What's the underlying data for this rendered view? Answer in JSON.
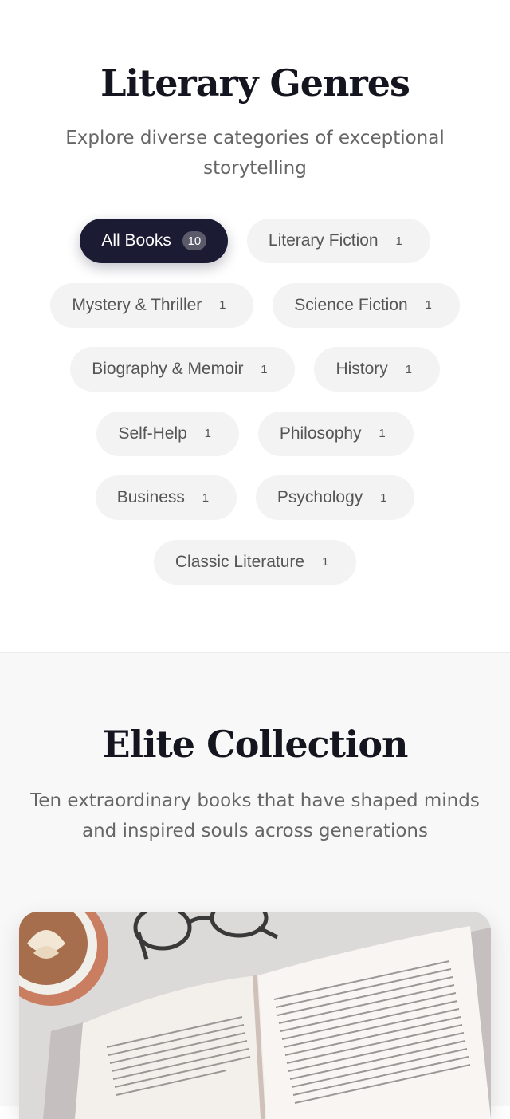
{
  "genres": {
    "title": "Literary Genres",
    "subtitle": "Explore diverse categories of exceptional storytelling",
    "chips": [
      {
        "label": "All Books",
        "count": "10",
        "active": true
      },
      {
        "label": "Literary Fiction",
        "count": "1"
      },
      {
        "label": "Mystery & Thriller",
        "count": "1"
      },
      {
        "label": "Science Fiction",
        "count": "1"
      },
      {
        "label": "Biography & Memoir",
        "count": "1"
      },
      {
        "label": "History",
        "count": "1"
      },
      {
        "label": "Self-Help",
        "count": "1"
      },
      {
        "label": "Philosophy",
        "count": "1"
      },
      {
        "label": "Business",
        "count": "1"
      },
      {
        "label": "Psychology",
        "count": "1"
      },
      {
        "label": "Classic Literature",
        "count": "1"
      }
    ]
  },
  "collection": {
    "title": "Elite Collection",
    "subtitle": "Ten extraordinary books that have shaped minds and inspired souls across generations"
  },
  "colors": {
    "active_chip_bg": "#1b1b33",
    "chip_bg": "#f3f3f3",
    "heading": "#15151f",
    "muted_text": "#666666"
  }
}
